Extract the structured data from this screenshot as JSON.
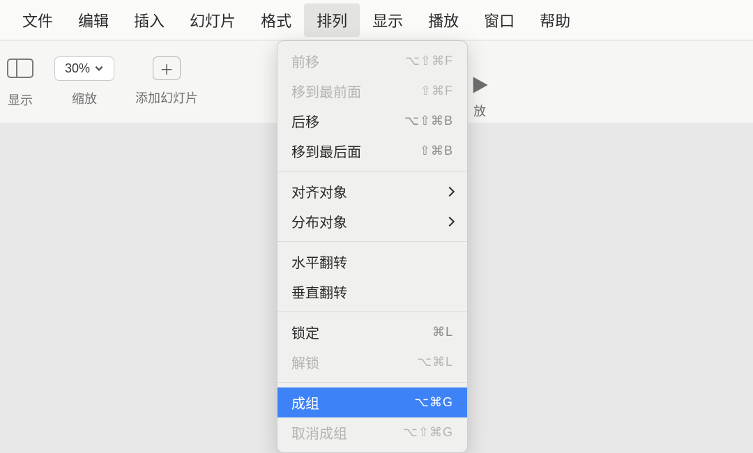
{
  "menubar": {
    "items": [
      {
        "label": "文件"
      },
      {
        "label": "编辑"
      },
      {
        "label": "插入"
      },
      {
        "label": "幻灯片"
      },
      {
        "label": "格式"
      },
      {
        "label": "排列",
        "active": true
      },
      {
        "label": "显示"
      },
      {
        "label": "播放"
      },
      {
        "label": "窗口"
      },
      {
        "label": "帮助"
      }
    ]
  },
  "toolbar": {
    "view_label": "显示",
    "zoom_value": "30%",
    "zoom_label": "缩放",
    "add_slide_label": "添加幻灯片",
    "play_partial": "放"
  },
  "dropdown": {
    "items": [
      {
        "label": "前移",
        "shortcut": "⌥⇧⌘F",
        "disabled": true
      },
      {
        "label": "移到最前面",
        "shortcut": "⇧⌘F",
        "disabled": true
      },
      {
        "label": "后移",
        "shortcut": "⌥⇧⌘B"
      },
      {
        "label": "移到最后面",
        "shortcut": "⇧⌘B"
      },
      {
        "type": "sep"
      },
      {
        "label": "对齐对象",
        "submenu": true
      },
      {
        "label": "分布对象",
        "submenu": true
      },
      {
        "type": "sep"
      },
      {
        "label": "水平翻转"
      },
      {
        "label": "垂直翻转"
      },
      {
        "type": "sep"
      },
      {
        "label": "锁定",
        "shortcut": "⌘L"
      },
      {
        "label": "解锁",
        "shortcut": "⌥⌘L",
        "disabled": true
      },
      {
        "type": "sep"
      },
      {
        "label": "成组",
        "shortcut": "⌥⌘G",
        "highlight": true
      },
      {
        "label": "取消成组",
        "shortcut": "⌥⇧⌘G",
        "disabled": true
      }
    ]
  }
}
